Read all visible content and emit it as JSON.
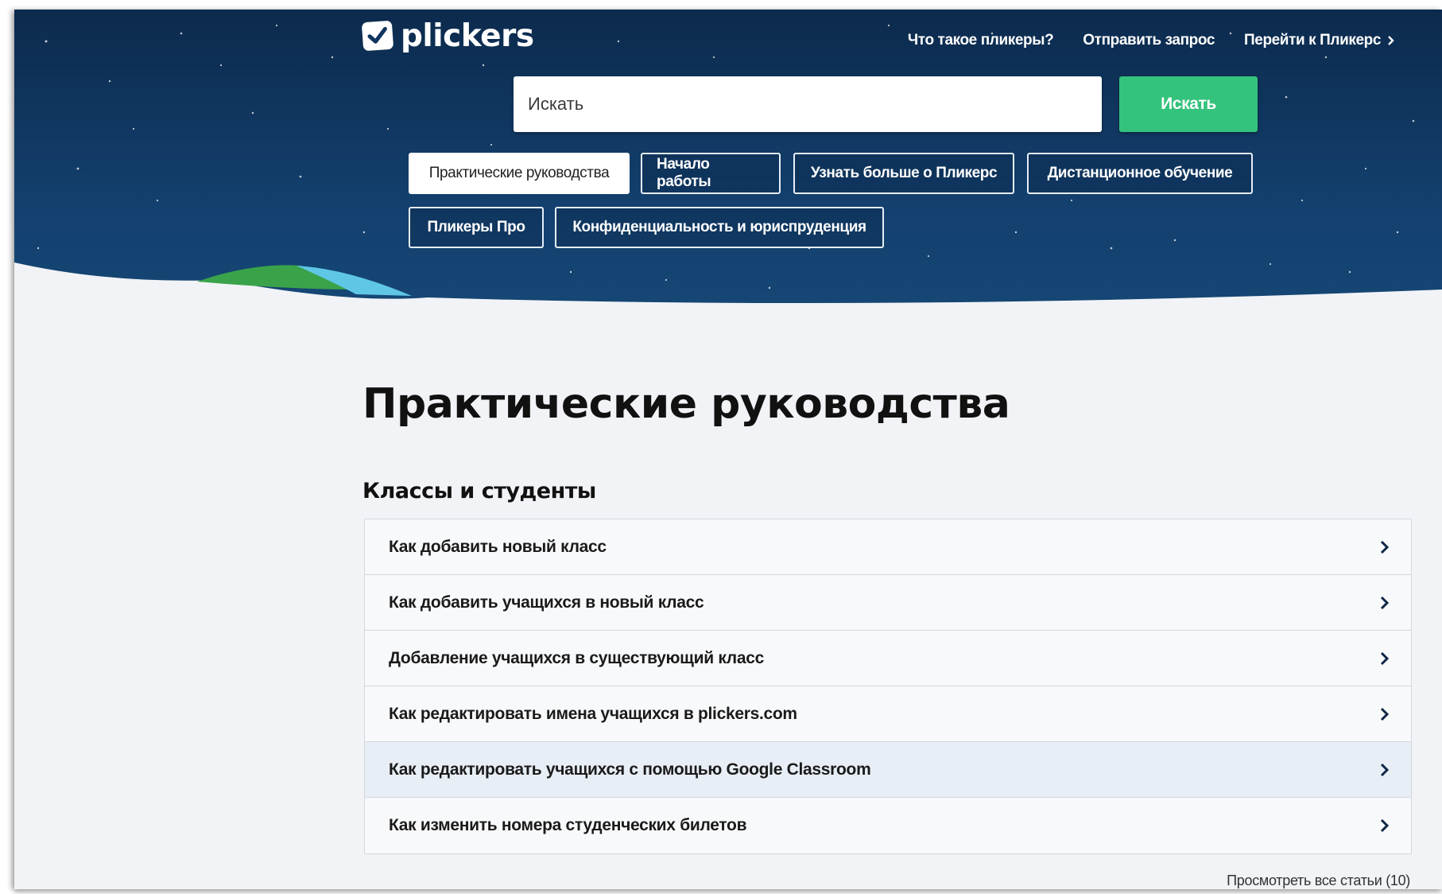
{
  "brand": {
    "name": "plickers"
  },
  "topnav": [
    {
      "label": "Что такое пликеры?"
    },
    {
      "label": "Отправить запрос"
    },
    {
      "label": "Перейти к Пликерс"
    }
  ],
  "search": {
    "placeholder": "Искать",
    "button_label": "Искать"
  },
  "categories": [
    {
      "label": "Практические руководства",
      "active": true
    },
    {
      "label": "Начало работы"
    },
    {
      "label": "Узнать больше о Пликерс"
    },
    {
      "label": "Дистанционное обучение"
    },
    {
      "label": "Пликеры Про"
    },
    {
      "label": "Конфиденциальность и юриспруденция"
    }
  ],
  "main": {
    "title": "Практические руководства",
    "section_title": "Классы и студенты",
    "articles": [
      {
        "label": "Как добавить новый класс"
      },
      {
        "label": "Как добавить учащихся в новый класс"
      },
      {
        "label": "Добавление учащихся в существующий класс"
      },
      {
        "label": "Как редактировать имена учащихся в plickers.com"
      },
      {
        "label": "Как редактировать учащихся с помощью Google Classroom"
      },
      {
        "label": "Как изменить номера студенческих билетов"
      }
    ],
    "view_all": "Просмотреть все статьи (10)"
  },
  "colors": {
    "hero_bg": "#0f3560",
    "accent_green": "#34c37c",
    "page_bg": "#f1f3f6"
  }
}
